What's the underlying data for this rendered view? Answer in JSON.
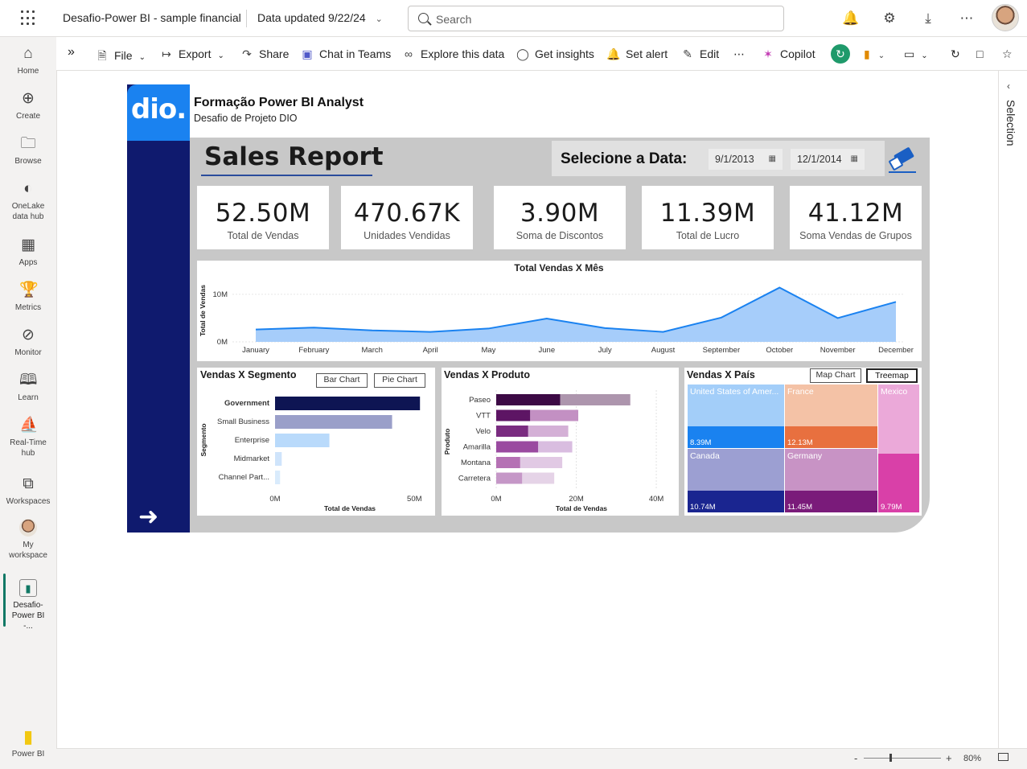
{
  "topbar": {
    "app_title": "Desafio-Power BI - sample financial",
    "data_updated": "Data updated 9/22/24",
    "search_placeholder": "Search"
  },
  "toolbar": {
    "file": "File",
    "export": "Export",
    "share": "Share",
    "chat_in_teams": "Chat in Teams",
    "explore": "Explore this data",
    "insights": "Get insights",
    "alert": "Set alert",
    "edit": "Edit",
    "copilot": "Copilot"
  },
  "rail": {
    "items": [
      {
        "label": "Home",
        "icon": "home-icon"
      },
      {
        "label": "Create",
        "icon": "plus-circle-icon"
      },
      {
        "label": "Browse",
        "icon": "folder-icon"
      },
      {
        "label": "OneLake data hub",
        "icon": "onelake-icon"
      },
      {
        "label": "Apps",
        "icon": "apps-icon"
      },
      {
        "label": "Metrics",
        "icon": "trophy-icon"
      },
      {
        "label": "Monitor",
        "icon": "monitor-icon"
      },
      {
        "label": "Learn",
        "icon": "book-icon"
      },
      {
        "label": "Real-Time hub",
        "icon": "realtime-icon"
      },
      {
        "label": "Workspaces",
        "icon": "workspaces-icon"
      },
      {
        "label": "My workspace",
        "icon": "avatar-icon"
      },
      {
        "label": "Desafio-Power BI -...",
        "icon": "report-icon"
      }
    ],
    "product": "Power BI"
  },
  "selection_pane": {
    "label": "Selection"
  },
  "statusbar": {
    "zoom": "80%"
  },
  "report": {
    "logo_text": "dio.",
    "header_title": "Formação Power BI Analyst",
    "header_subtitle": "Desafio de Projeto DIO",
    "title": "Sales Report",
    "date_label": "Selecione a Data:",
    "date_start": "9/1/2013",
    "date_end": "12/1/2014",
    "kpis": [
      {
        "value": "52.50M",
        "label": "Total de Vendas"
      },
      {
        "value": "470.67K",
        "label": "Unidades Vendidas"
      },
      {
        "value": "3.90M",
        "label": "Soma de Discontos"
      },
      {
        "value": "11.39M",
        "label": "Total de Lucro"
      },
      {
        "value": "41.12M",
        "label": "Soma Vendas de Grupos"
      }
    ],
    "segment_buttons": {
      "bar": "Bar Chart",
      "pie": "Pie Chart"
    },
    "country_buttons": {
      "map": "Map Chart",
      "treemap": "Treemap"
    },
    "colors": {
      "nav": "#0f1a6e",
      "logo": "#1a82f0",
      "area": "#1a82f0",
      "area_fill": "#a6cdfa"
    }
  },
  "chart_data": [
    {
      "type": "area",
      "title": "Total Vendas X Mês",
      "ylabel": "Total de Vendas",
      "categories": [
        "January",
        "February",
        "March",
        "April",
        "May",
        "June",
        "July",
        "August",
        "September",
        "October",
        "November",
        "December"
      ],
      "values": [
        2.6,
        3.0,
        2.4,
        2.1,
        2.8,
        4.9,
        2.9,
        2.1,
        5.1,
        11.4,
        5.0,
        8.4
      ],
      "y_ticks": [
        "0M",
        "10M"
      ],
      "ylim": [
        0,
        12
      ]
    },
    {
      "type": "bar",
      "title": "Vendas X Segmento",
      "ylabel": "Segmento",
      "xlabel": "Total de Vendas",
      "categories": [
        "Government",
        "Small Business",
        "Enterprise",
        "Midmarket",
        "Channel Part..."
      ],
      "values": [
        52.0,
        42.0,
        19.5,
        2.4,
        1.8
      ],
      "colors": [
        "#0e1553",
        "#9a9fc9",
        "#b9dafb",
        "#cfe4fb",
        "#d9ebfc"
      ],
      "x_ticks": [
        "0M",
        "50M"
      ],
      "xlim": [
        0,
        58
      ]
    },
    {
      "type": "bar",
      "title": "Vendas X Produto",
      "ylabel": "Produto",
      "xlabel": "Total de Vendas",
      "categories": [
        "Paseo",
        "VTT",
        "Velo",
        "Amarilla",
        "Montana",
        "Carretera"
      ],
      "series": [
        {
          "values": [
            16.0,
            8.5,
            8.0,
            10.5,
            6.0,
            6.5
          ]
        },
        {
          "values": [
            17.5,
            12.0,
            10.0,
            8.5,
            10.5,
            8.0
          ]
        }
      ],
      "colors": [
        "#3d0a45",
        "#5d1564",
        "#7a2c80",
        "#9a4aa0",
        "#b571b4",
        "#c597c7"
      ],
      "light_colors": [
        "#ad95ad",
        "#c390c3",
        "#d4b0d6",
        "#d9bde0",
        "#e1c9e4",
        "#e5d3e7"
      ],
      "x_ticks": [
        "0M",
        "20M",
        "40M"
      ],
      "xlim": [
        0,
        43
      ]
    },
    {
      "type": "treemap",
      "title": "Vendas X País",
      "categories": [
        "United States of Amer...",
        "France",
        "Mexico",
        "Canada",
        "Germany"
      ],
      "values": [
        8.39,
        12.13,
        9.79,
        10.74,
        11.45
      ],
      "labels": [
        "8.39M",
        "12.13M",
        "9.79M",
        "10.74M",
        "11.45M"
      ]
    }
  ]
}
